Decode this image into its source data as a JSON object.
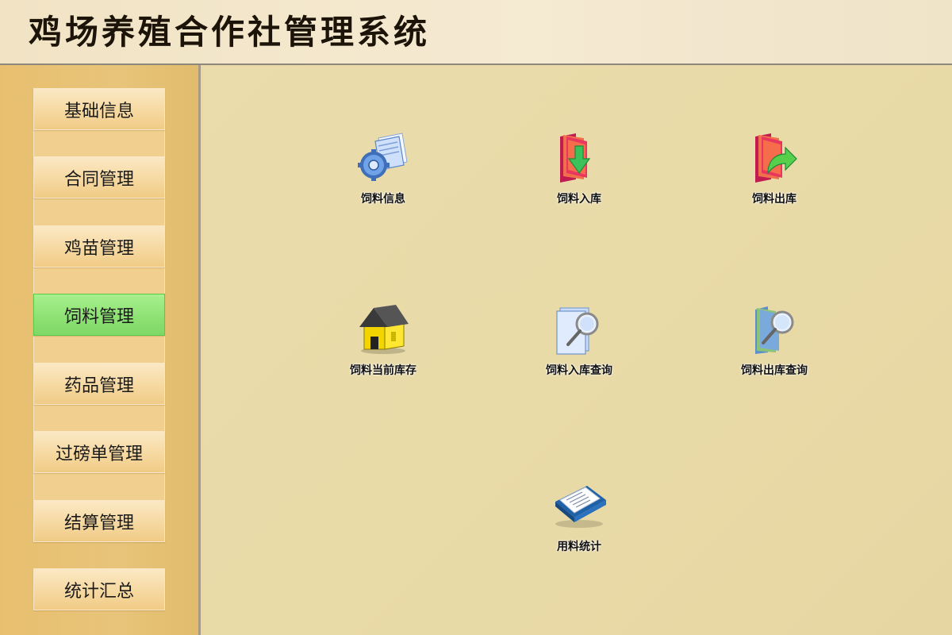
{
  "app": {
    "title": "鸡场养殖合作社管理系统"
  },
  "sidebar": {
    "items": [
      {
        "label": "基础信息",
        "active": false
      },
      {
        "label": "合同管理",
        "active": false
      },
      {
        "label": "鸡苗管理",
        "active": false
      },
      {
        "label": "饲料管理",
        "active": true
      },
      {
        "label": "药品管理",
        "active": false
      },
      {
        "label": "过磅单管理",
        "active": false
      },
      {
        "label": "结算管理",
        "active": false
      },
      {
        "label": "统计汇总",
        "active": false
      }
    ]
  },
  "main": {
    "tiles": [
      {
        "label": "饲料信息",
        "icon": "settings-document-icon"
      },
      {
        "label": "饲料入库",
        "icon": "folder-download-icon"
      },
      {
        "label": "饲料出库",
        "icon": "folder-export-icon"
      },
      {
        "label": "饲料当前库存",
        "icon": "warehouse-icon"
      },
      {
        "label": "饲料入库查询",
        "icon": "document-search-icon"
      },
      {
        "label": "饲料出库查询",
        "icon": "folder-search-icon"
      },
      {
        "label": "用料统计",
        "icon": "book-icon"
      }
    ]
  },
  "colors": {
    "active_menu": "#8ee274",
    "sidebar_bg": "#e7c47a",
    "main_bg": "#eadcab"
  }
}
